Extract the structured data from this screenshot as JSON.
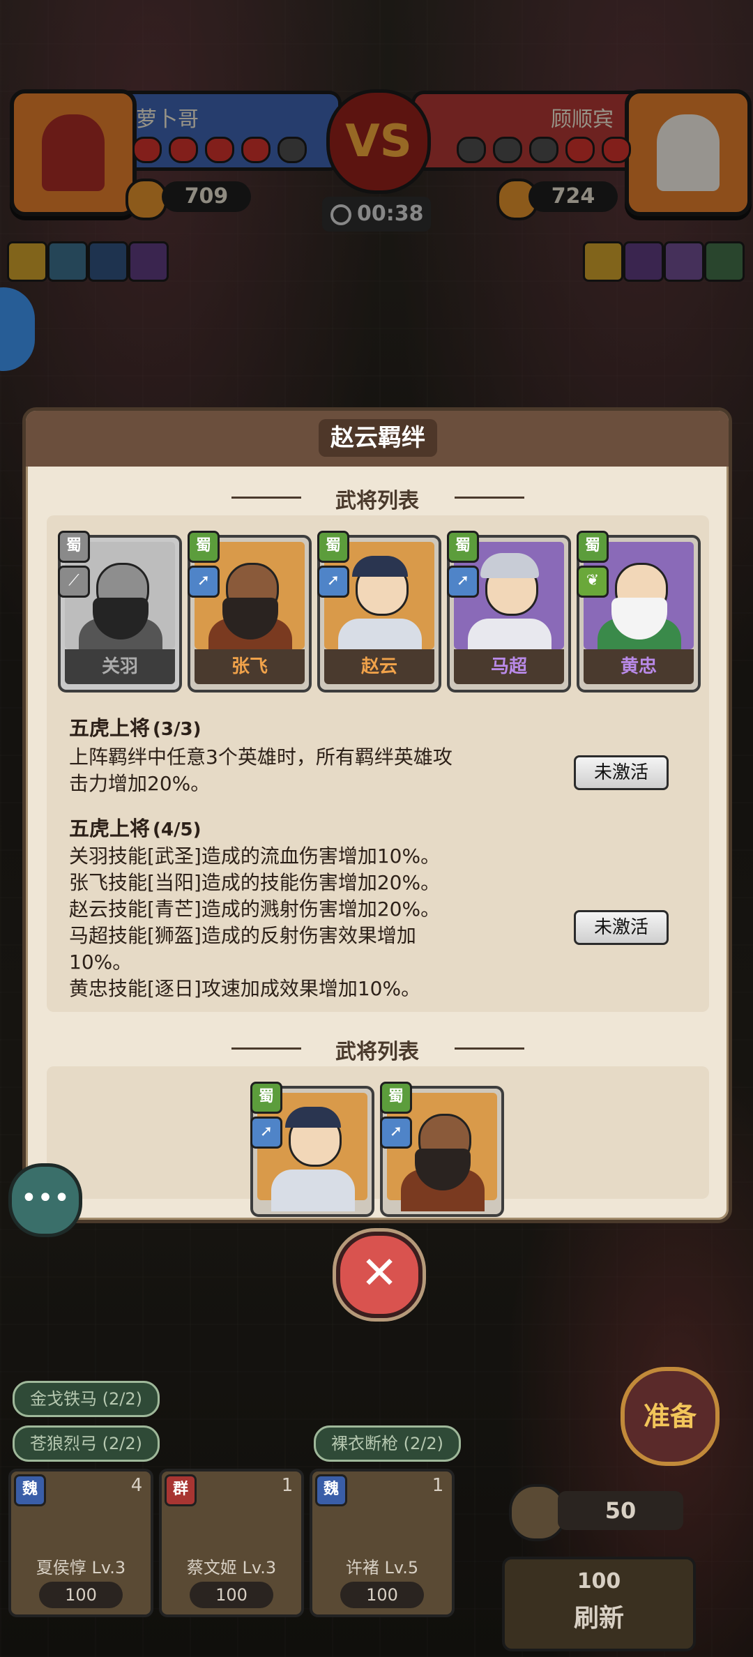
{
  "hud": {
    "player_left": {
      "name": "萝卜哥",
      "coins": "709",
      "hearts_filled": 4,
      "hearts_total": 5
    },
    "player_right": {
      "name": "顾顺宾",
      "coins": "724",
      "hearts_filled": 2,
      "hearts_total": 5
    },
    "vs_label": "VS",
    "timer": "00:38"
  },
  "modal": {
    "title": "赵云羁绊",
    "section1_title": "武将列表",
    "generals": [
      {
        "name": "关羽",
        "faction": "蜀",
        "weapon_icon": "blade-icon",
        "greyed": true
      },
      {
        "name": "张飞",
        "faction": "蜀",
        "weapon_icon": "spear-icon",
        "greyed": false
      },
      {
        "name": "赵云",
        "faction": "蜀",
        "weapon_icon": "spear-icon",
        "greyed": false
      },
      {
        "name": "马超",
        "faction": "蜀",
        "weapon_icon": "spear-icon",
        "greyed": false
      },
      {
        "name": "黄忠",
        "faction": "蜀",
        "weapon_icon": "leaf-icon",
        "greyed": false
      }
    ],
    "bonds": [
      {
        "title": "五虎上将",
        "count": "(3/3)",
        "lines": [
          "上阵羁绊中任意3个英雄时，所有羁绊英雄攻",
          "击力增加20%。"
        ],
        "status": "未激活"
      },
      {
        "title": "五虎上将",
        "count": "(4/5)",
        "lines": [
          "关羽技能[武圣]造成的流血伤害增加10%。",
          "张飞技能[当阳]造成的技能伤害增加20%。",
          "赵云技能[青芒]造成的溅射伤害增加20%。",
          "马超技能[狮盔]造成的反射伤害效果增加",
          "10%。",
          "黄忠技能[逐日]攻速加成效果增加10%。"
        ],
        "status": "未激活"
      }
    ],
    "section2_title": "武将列表",
    "generals2": [
      {
        "faction": "蜀"
      },
      {
        "faction": "蜀"
      }
    ]
  },
  "bottom": {
    "tags": [
      "金戈铁马 (2/2)",
      "苍狼烈弓 (2/2)",
      "裸衣断枪 (2/2)"
    ],
    "ready_label": "准备",
    "gold": "50",
    "units": [
      {
        "name": "夏侯惇 Lv.3",
        "faction": "魏",
        "star": "4",
        "cost": "100"
      },
      {
        "name": "蔡文姬 Lv.3",
        "faction": "群",
        "star": "1",
        "cost": "100"
      },
      {
        "name": "许褚 Lv.5",
        "faction": "魏",
        "star": "1",
        "cost": "100"
      }
    ],
    "refresh_cost": "100",
    "refresh_label": "刷新"
  },
  "colors": {
    "modal_bg": "#efe6d6",
    "modal_header": "#6b4f3d",
    "shu_green": "#5c9d3c",
    "orange_name": "#f0a24a"
  }
}
